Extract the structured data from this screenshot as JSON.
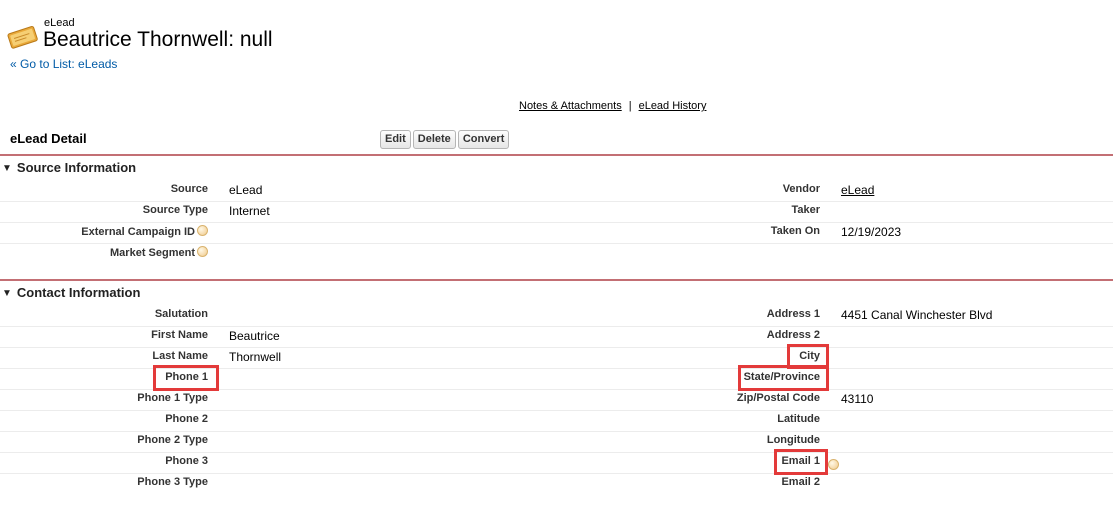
{
  "header": {
    "object_type": "eLead",
    "title": "Beautrice Thornwell: null",
    "back_prefix": "« ",
    "back_link": "Go to List: eLeads",
    "icon": "elead-tag-icon"
  },
  "related_links": [
    "Notes & Attachments",
    "eLead History"
  ],
  "related_sep": "|",
  "detail": {
    "title": "eLead Detail",
    "buttons": [
      "Edit",
      "Delete",
      "Convert"
    ]
  },
  "sections": {
    "source": {
      "title": "Source Information",
      "rows": [
        {
          "left_label": "Source",
          "left_value": "eLead",
          "right_label": "Vendor",
          "right_value": "eLead"
        },
        {
          "left_label": "Source Type",
          "left_value": "Internet",
          "right_label": "Taker",
          "right_value": ""
        },
        {
          "left_label": "External Campaign ID",
          "left_value": "",
          "right_label": "Taken On",
          "right_value": "12/19/2023"
        },
        {
          "left_label": "Market Segment",
          "left_value": "",
          "right_label": "",
          "right_value": ""
        }
      ]
    },
    "contact": {
      "title": "Contact Information",
      "rows": [
        {
          "left_label": "Salutation",
          "left_value": "",
          "right_label": "Address 1",
          "right_value": "4451 Canal Winchester Blvd"
        },
        {
          "left_label": "First Name",
          "left_value": "Beautrice",
          "right_label": "Address 2",
          "right_value": ""
        },
        {
          "left_label": "Last Name",
          "left_value": "Thornwell",
          "right_label": "City",
          "right_value": ""
        },
        {
          "left_label": "Phone 1",
          "left_value": "",
          "right_label": "State/Province",
          "right_value": ""
        },
        {
          "left_label": "Phone 1 Type",
          "left_value": "",
          "right_label": "Zip/Postal Code",
          "right_value": "43110"
        },
        {
          "left_label": "Phone 2",
          "left_value": "",
          "right_label": "Latitude",
          "right_value": ""
        },
        {
          "left_label": "Phone 2 Type",
          "left_value": "",
          "right_label": "Longitude",
          "right_value": ""
        },
        {
          "left_label": "Phone 3",
          "left_value": "",
          "right_label": "Email 1",
          "right_value": ""
        },
        {
          "left_label": "Phone 3 Type",
          "left_value": "",
          "right_label": "Email 2",
          "right_value": ""
        }
      ]
    }
  },
  "colors": {
    "link": "#015ba7",
    "section_rule": "#b9565c",
    "highlight": "#e33a3a"
  }
}
